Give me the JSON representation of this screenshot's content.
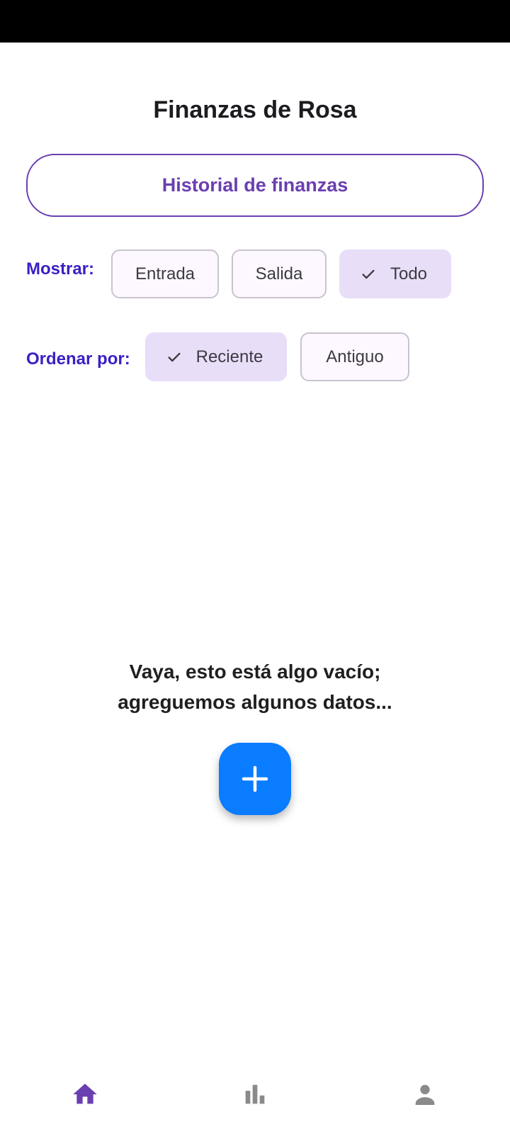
{
  "app": {
    "title": "Finanzas de Rosa"
  },
  "history_button": {
    "label": "Historial de finanzas"
  },
  "show_filter": {
    "label": "Mostrar:",
    "options": [
      {
        "label": "Entrada",
        "selected": false
      },
      {
        "label": "Salida",
        "selected": false
      },
      {
        "label": "Todo",
        "selected": true
      }
    ]
  },
  "sort_filter": {
    "label": "Ordenar por:",
    "options": [
      {
        "label": "Reciente",
        "selected": true
      },
      {
        "label": "Antiguo",
        "selected": false
      }
    ]
  },
  "empty_state": {
    "line1": "Vaya, esto está algo vacío;",
    "line2": "agreguemos algunos datos..."
  },
  "fab": {
    "icon": "plus-icon",
    "color": "#0a7cff"
  },
  "bottom_nav": {
    "items": [
      {
        "icon": "home-icon",
        "active": true
      },
      {
        "icon": "bar-chart-icon",
        "active": false
      },
      {
        "icon": "person-icon",
        "active": false
      }
    ],
    "active_color": "#6a3fb0",
    "inactive_color": "#8a8a8a"
  },
  "colors": {
    "accent": "#6a3fb0",
    "label": "#3a1fc4",
    "chip_selected_bg": "#e8def8"
  }
}
